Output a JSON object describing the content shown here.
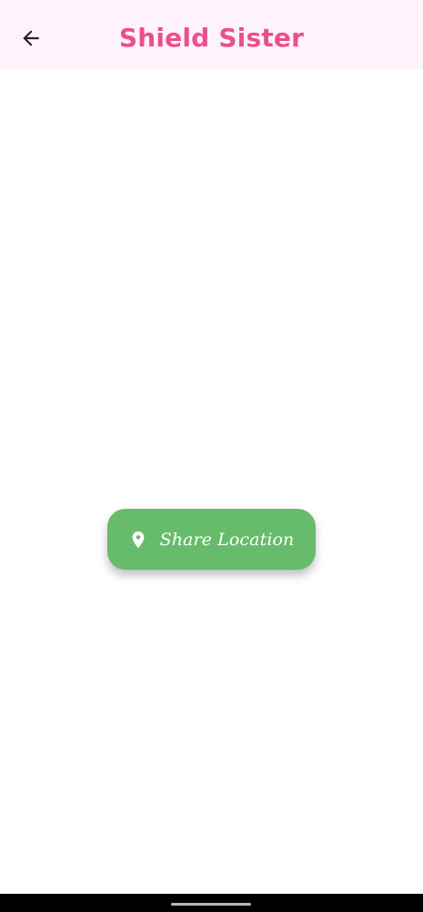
{
  "app_bar": {
    "title": "Shield Sister",
    "back_icon": "arrow-left-icon",
    "background": "#fff3fb",
    "title_color": "#ea4f8e"
  },
  "main": {
    "share_button": {
      "label": "Share Location",
      "icon": "location-pin-icon",
      "background": "#66bc6a"
    }
  },
  "system_bar": {
    "home_indicator": "gesture-navigation-handle"
  }
}
